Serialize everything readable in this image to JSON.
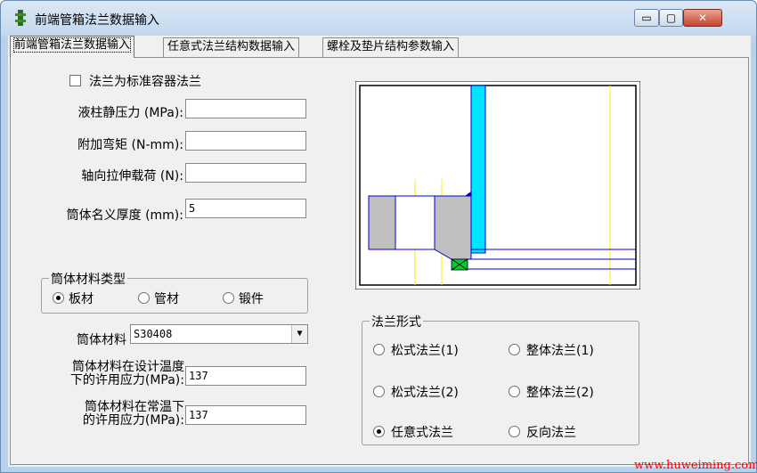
{
  "window": {
    "title": "前端管箱法兰数据输入",
    "controls": {
      "minimize": "▭",
      "maximize": "▢",
      "close": "✕"
    }
  },
  "tabs": [
    {
      "label": "前端管箱法兰数据输入",
      "active": true
    },
    {
      "label": "任意式法兰结构数据输入",
      "active": false
    },
    {
      "label": "螺栓及垫片结构参数输入",
      "active": false
    }
  ],
  "form": {
    "standard_flange_label": "法兰为标准容器法兰",
    "standard_flange_checked": false,
    "hydrostatic_label": "液柱静压力 (MPa):",
    "hydrostatic_value": "",
    "bending_moment_label": "附加弯矩 (N-mm):",
    "bending_moment_value": "",
    "axial_load_label": "轴向拉伸载荷 (N):",
    "axial_load_value": "",
    "shell_thickness_label": "筒体名义厚度 (mm):",
    "shell_thickness_value": "5",
    "material_type_group": "筒体材料类型",
    "material_types": [
      "板材",
      "管材",
      "锻件"
    ],
    "material_type_selected": "板材",
    "shell_material_label": "筒体材料",
    "shell_material_value": "S30408",
    "design_stress_label_1": "筒体材料在设计温度",
    "design_stress_label_2": "下的许用应力(MPa):",
    "design_stress_value": "137",
    "ambient_stress_label_1": "筒体材料在常温下",
    "ambient_stress_label_2": "的许用应力(MPa):",
    "ambient_stress_value": "137"
  },
  "flange_form": {
    "group": "法兰形式",
    "options": [
      "松式法兰(1)",
      "整体法兰(1)",
      "松式法兰(2)",
      "整体法兰(2)",
      "任意式法兰",
      "反向法兰"
    ],
    "selected": "任意式法兰"
  },
  "colors": {
    "accent_cyan": "#00e5ff",
    "outline_blue": "#0000cc",
    "flange_gray": "#c0c0c0",
    "guide_yellow": "#ffee00",
    "gasket_green": "#00cc33"
  },
  "watermark": "www.huweiming.com"
}
